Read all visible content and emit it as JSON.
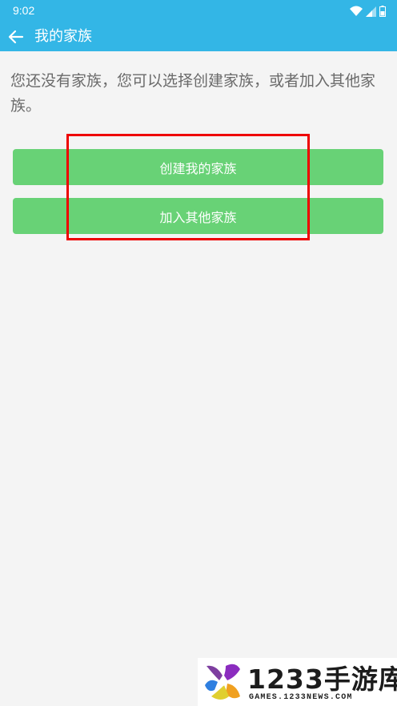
{
  "status_bar": {
    "time": "9:02",
    "icons": [
      "wifi-icon",
      "signal-icon",
      "battery-icon"
    ]
  },
  "app_bar": {
    "back_icon": "arrow-left-icon",
    "title": "我的家族"
  },
  "content": {
    "message": "您还没有家族，您可以选择创建家族，或者加入其他家族。",
    "create_button_label": "创建我的家族",
    "join_button_label": "加入其他家族"
  },
  "watermark": {
    "title": "1233手游库",
    "url": "GAMES.1233NEWS.COM"
  },
  "colors": {
    "app_bar": "#33b6e6",
    "button": "#68d276",
    "background": "#f4f4f4",
    "highlight": "#ee0000",
    "message_text": "#6a6a6a"
  }
}
